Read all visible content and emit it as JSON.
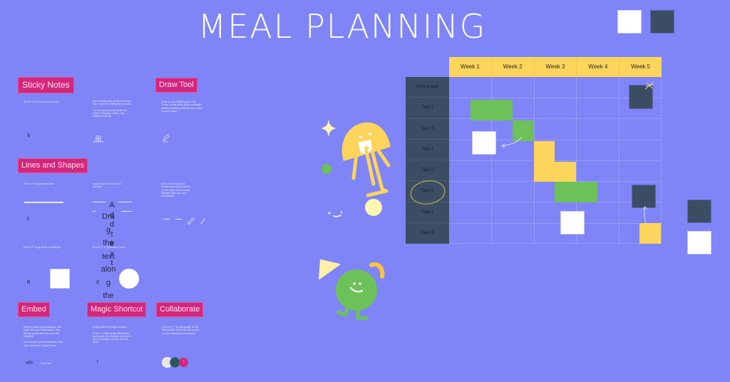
{
  "title": "MEAL PLANNING",
  "colors": {
    "background": "#7f85f6",
    "pink_label": "#d4267c",
    "navy": "#3b4d62",
    "yellow": "#fdd45c",
    "green": "#6cc258",
    "white": "#ffffff"
  },
  "guide": {
    "sticky_notes": {
      "label": "Sticky Notes",
      "text1": "Press \"S\" to create sticky notes.",
      "text2": "Alternatively, click on the Elements tab to open the Sticky Notes panel.\n\nYou can also access panels for Lines & Shapes, Charts, and Tables in this tab.",
      "key": "S",
      "elements_caption": "Elements"
    },
    "draw_tool": {
      "label": "Draw Tool",
      "text": "Draw on your Whiteboard! Click \"Draw\" on the editor (left) to activate different drawing tools and the eraser on your board.",
      "caption": "Draw"
    },
    "lines_and_shapes": {
      "label": "Lines and Shapes",
      "text1": "Press \"L\" to generate lines.",
      "text2": "Double click on the line to add text.",
      "text3": "Click on the lines and choose among the options on the editor bar to create elbowed lines and add arrowheads.",
      "key": "L",
      "add_text_vertical": [
        "A",
        "d",
        "d",
        "t",
        "e",
        "x",
        "t"
      ],
      "drag_text_vertical": [
        "Dra",
        "g",
        "the",
        "text",
        "alon",
        "g",
        "the"
      ]
    },
    "shapes": {
      "text_rect": "Press \"R\" to generate a rectangle.",
      "text_circle": "Press \"C\" to generate a circle.",
      "key_rect": "R",
      "key_circle": "C"
    },
    "embed": {
      "label": "Embed",
      "text": "Embed videos, presentations, and more onto your Whiteboard. Just directly paste their links onto the template!\n\nYou can also access Embeds in the Apps Tab of the Object Panel.",
      "icon_caption": "Copy Link"
    },
    "magic_shortcut": {
      "label": "Magic Shortcut",
      "text": "Design with the Magic shortcut.\n\nPress \"/\" while on the Whiteboard and search for whatever you need, such as images, charts, and the timer!",
      "key": "/"
    },
    "collaborate": {
      "label": "Collaborate",
      "text": "Click the \"+\" to add people to the Whiteboard. Share the link so you can all collaborate in real time!",
      "add_symbol": "+"
    }
  },
  "planner": {
    "weeks": [
      "Week 1",
      "Week 2",
      "Week 3",
      "Week 4",
      "Week 5"
    ],
    "tasks": [
      "Write a task",
      "Task 2",
      "Task 3",
      "Task 4",
      "Task 5",
      "Task 6",
      "Task 7",
      "Task 8"
    ],
    "highlighted_task": "Task 6"
  }
}
